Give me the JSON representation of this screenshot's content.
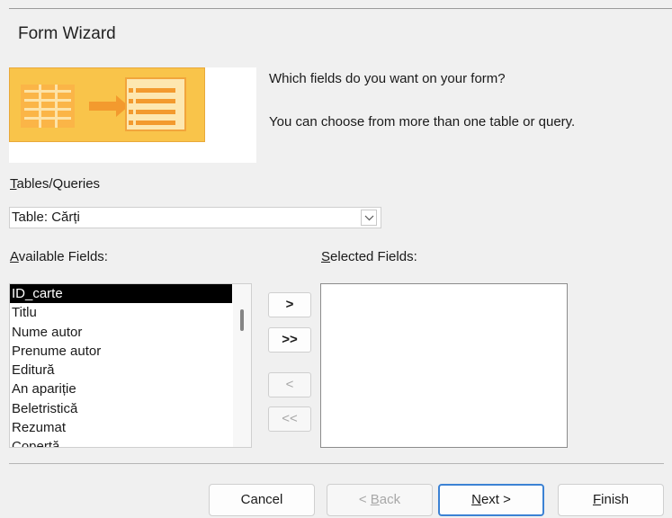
{
  "window": {
    "title": "Form Wizard"
  },
  "prompt": {
    "question": "Which fields do you want on your form?",
    "hint": "You can choose from more than one table or query."
  },
  "tables_queries": {
    "label_mnemonic": "T",
    "label_rest": "ables/Queries",
    "selected_value": "Table: Cărți"
  },
  "available_fields": {
    "label_mnemonic": "A",
    "label_rest": "vailable Fields:",
    "items": [
      "ID_carte",
      "Titlu",
      "Nume autor",
      "Prenume autor",
      "Editură",
      "An apariție",
      "Beletristică",
      "Rezumat",
      "Copertă"
    ],
    "selected_index": 0
  },
  "selected_fields": {
    "label_mnemonic": "S",
    "label_rest": "elected Fields:",
    "items": []
  },
  "move_buttons": {
    "add_one": ">",
    "add_all": ">>",
    "remove_one": "<",
    "remove_all": "<<"
  },
  "footer": {
    "cancel": "Cancel",
    "back_prefix": "< ",
    "back_mnemonic": "B",
    "back_rest": "ack",
    "next_mnemonic": "N",
    "next_rest": "ext >",
    "finish_mnemonic": "F",
    "finish_rest": "inish"
  },
  "colors": {
    "accent_default_button": "#3c82d4",
    "banner_yellow": "#f9c44a",
    "banner_orange": "#f39a2e"
  }
}
